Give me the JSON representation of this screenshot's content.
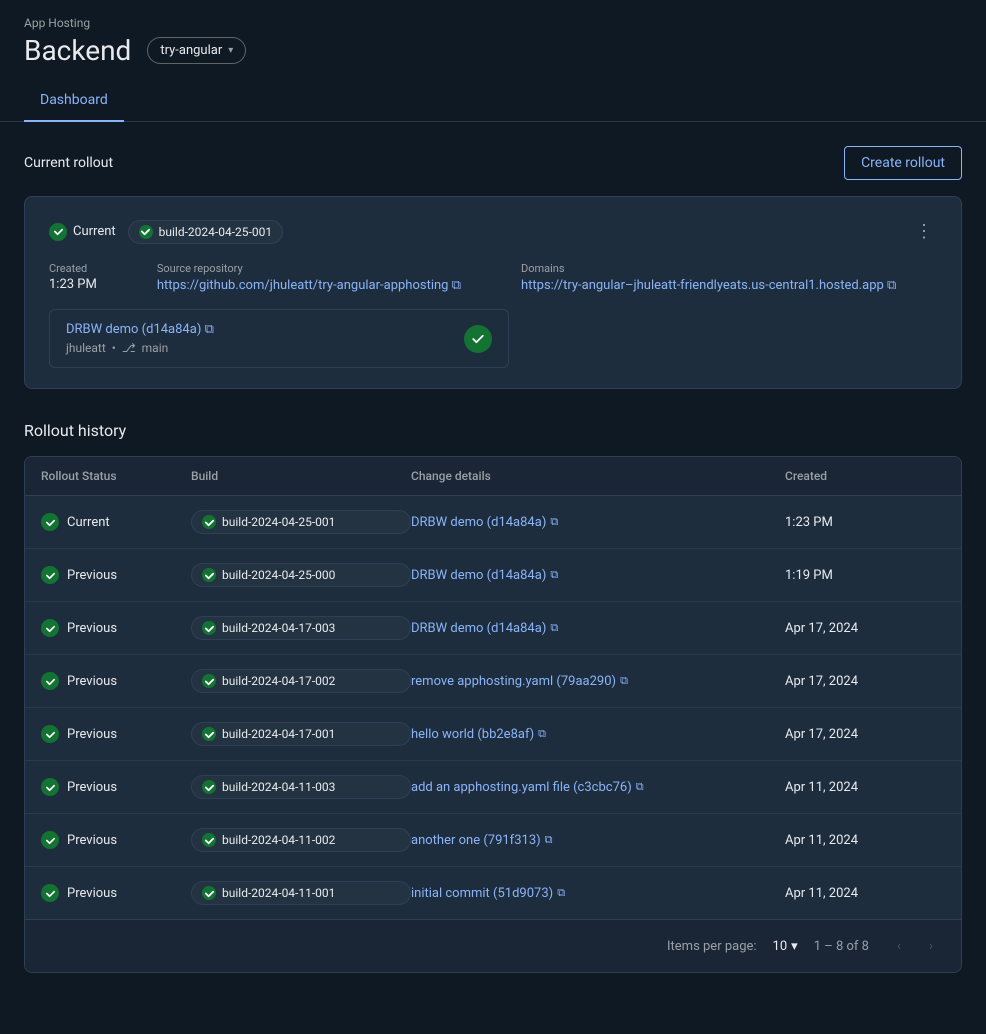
{
  "header": {
    "app_hosting": "App Hosting",
    "title": "Backend",
    "branch": "try-angular",
    "tab_dashboard": "Dashboard"
  },
  "current_rollout": {
    "section_title": "Current rollout",
    "create_button": "Create rollout",
    "status": "Current",
    "build_id": "build-2024-04-25-001",
    "created_label": "Created",
    "created_value": "1:23 PM",
    "source_repo_label": "Source repository",
    "source_repo_url": "https://github.com/jhuleatt/try-angular-apphosting",
    "source_repo_display": "https://github.com/jhuleatt/try-angular-apphosting ⧉",
    "domains_label": "Domains",
    "domain_url": "https://try-angular-jhuleatt-friendlyeats.us-central1.hosted.app",
    "domain_display": "https://try-angular–jhuleatt-friendlyeats.us-central1.hosted.app ⧉",
    "commit_link": "DRBW demo (d14a84a) ⧉",
    "commit_author": "jhuleatt",
    "commit_branch": "main"
  },
  "rollout_history": {
    "title": "Rollout history",
    "columns": {
      "status": "Rollout Status",
      "build": "Build",
      "change": "Change details",
      "created": "Created"
    },
    "rows": [
      {
        "status": "Current",
        "build": "build-2024-04-25-001",
        "change": "DRBW demo (d14a84a)",
        "created": "1:23 PM"
      },
      {
        "status": "Previous",
        "build": "build-2024-04-25-000",
        "change": "DRBW demo (d14a84a)",
        "created": "1:19 PM"
      },
      {
        "status": "Previous",
        "build": "build-2024-04-17-003",
        "change": "DRBW demo (d14a84a)",
        "created": "Apr 17, 2024"
      },
      {
        "status": "Previous",
        "build": "build-2024-04-17-002",
        "change": "remove apphosting.yaml (79aa290)",
        "created": "Apr 17, 2024"
      },
      {
        "status": "Previous",
        "build": "build-2024-04-17-001",
        "change": "hello world (bb2e8af)",
        "created": "Apr 17, 2024"
      },
      {
        "status": "Previous",
        "build": "build-2024-04-11-003",
        "change": "add an apphosting.yaml file (c3cbc76)",
        "created": "Apr 11, 2024"
      },
      {
        "status": "Previous",
        "build": "build-2024-04-11-002",
        "change": "another one (791f313)",
        "created": "Apr 11, 2024"
      },
      {
        "status": "Previous",
        "build": "build-2024-04-11-001",
        "change": "initial commit (51d9073)",
        "created": "Apr 11, 2024"
      }
    ],
    "pagination": {
      "items_per_page_label": "Items per page:",
      "per_page": "10",
      "range": "1 – 8 of 8"
    }
  }
}
